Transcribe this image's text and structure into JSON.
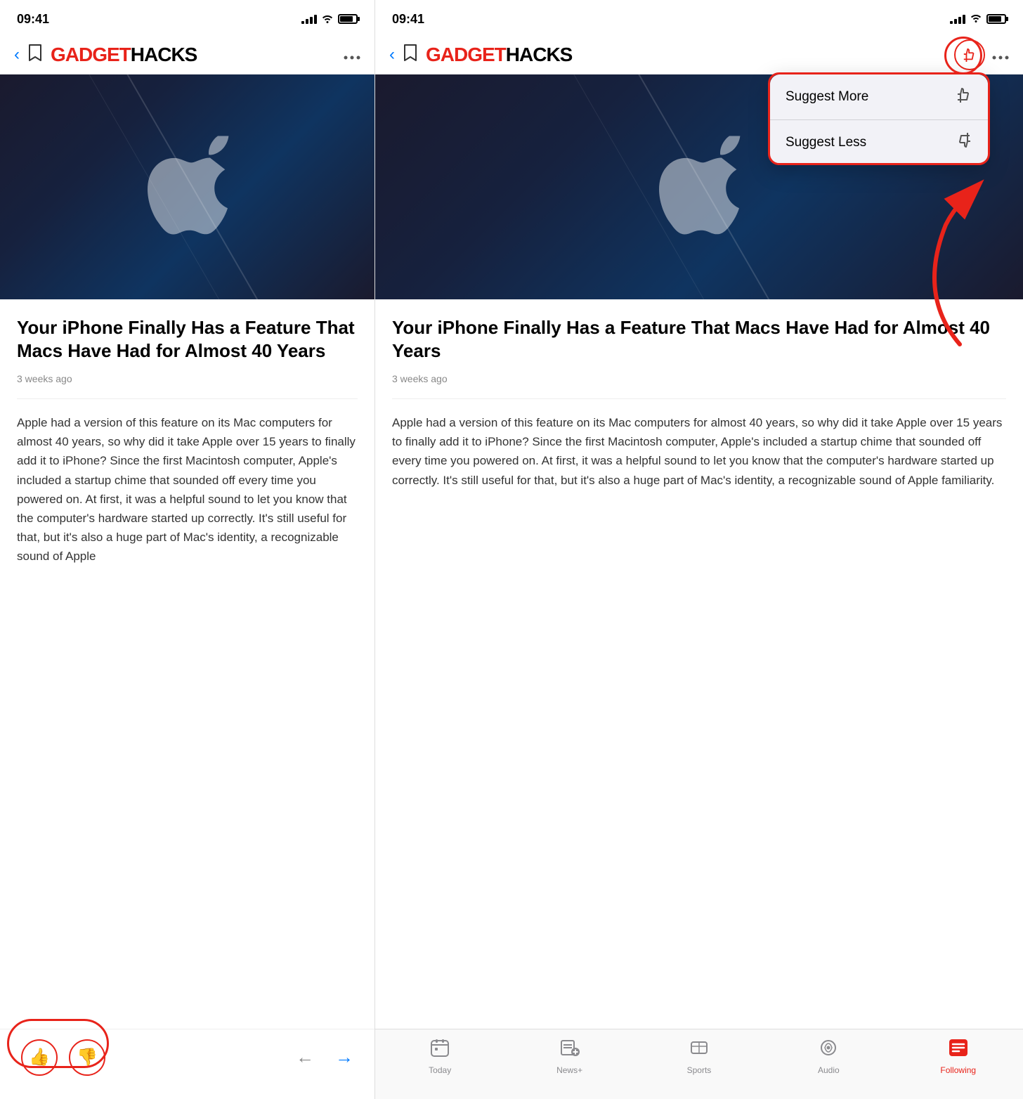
{
  "left_phone": {
    "status_time": "09:41",
    "nav": {
      "bookmark_icon": "bookmark",
      "more_icon": "ellipsis",
      "logo_part1": "GADGET",
      "logo_part2": "HACKS"
    },
    "article": {
      "title": "Your iPhone Finally Has a Feature That Macs Have Had for Almost 40 Years",
      "date": "3 weeks ago",
      "body": "Apple had a version of this feature on its Mac computers for almost 40 years, so why did it take Apple over 15 years to finally add it to iPhone? Since the first Macintosh computer, Apple's included a startup chime that sounded off every time you powered on. At first, it was a helpful sound to let you know that the computer's hardware started up correctly. It's still useful for that, but it's also a huge part of Mac's identity, a recognizable sound of Apple"
    },
    "toolbar": {
      "thumb_up": "👍",
      "thumb_down": "👎",
      "nav_back": "←",
      "nav_forward": "→"
    }
  },
  "right_phone": {
    "status_time": "09:41",
    "nav": {
      "back_icon": "back",
      "bookmark_icon": "bookmark",
      "logo_part1": "GADGET",
      "logo_part2": "HACKS",
      "suggest_icon": "thumbs",
      "more_icon": "ellipsis"
    },
    "dropdown": {
      "suggest_more_label": "Suggest More",
      "suggest_less_label": "Suggest Less",
      "suggest_more_icon": "👍",
      "suggest_less_icon": "👎"
    },
    "article": {
      "title": "Your iPhone Finally Has a Feature That Macs Have Had for Almost 40 Years",
      "date": "3 weeks ago",
      "body": "Apple had a version of this feature on its Mac computers for almost 40 years, so why did it take Apple over 15 years to finally add it to iPhone? Since the first Macintosh computer, Apple's included a startup chime that sounded off every time you powered on. At first, it was a helpful sound to let you know that the computer's hardware started up correctly. It's still useful for that, but it's also a huge part of Mac's identity, a recognizable sound of Apple familiarity."
    },
    "tab_bar": {
      "tabs": [
        {
          "id": "today",
          "label": "Today",
          "active": false
        },
        {
          "id": "news_plus",
          "label": "News+",
          "active": false
        },
        {
          "id": "sports",
          "label": "Sports",
          "active": false
        },
        {
          "id": "audio",
          "label": "Audio",
          "active": false
        },
        {
          "id": "following",
          "label": "Following",
          "active": true
        }
      ]
    }
  }
}
